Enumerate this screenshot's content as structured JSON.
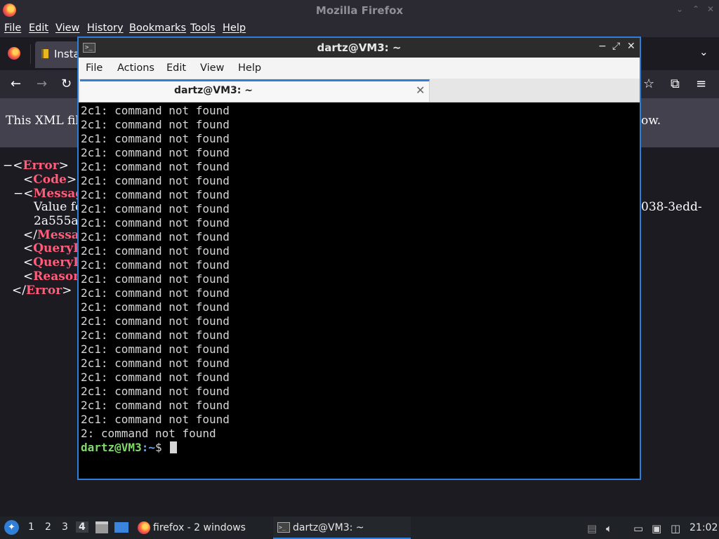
{
  "firefox": {
    "window_title": "Mozilla Firefox",
    "window_controls": [
      "⌄",
      "⌃",
      "✕"
    ],
    "menu": [
      "File",
      "Edit",
      "View",
      "History",
      "Bookmarks",
      "Tools",
      "Help"
    ],
    "tab_label": "Insta",
    "infobar_left": "This XML file",
    "infobar_right": "ow.",
    "xml_lines": {
      "l1_prefix": "−<",
      "l1_tag": "Error",
      "l1_suffix": ">",
      "l2_prefix": "<",
      "l2_tag": "Code",
      "l2_suffix": ">I",
      "l3_prefix": "−<",
      "l3_tag": "Messag",
      "l4_text": "Value fo",
      "l4_right": "038-3edd-",
      "l5_text": "2a555a",
      "l6_prefix": "</",
      "l6_tag": "Messag",
      "l7_prefix": "<",
      "l7_tag": "QueryP",
      "l8_prefix": "<",
      "l8_tag": "QueryP",
      "l9_prefix": "<",
      "l9_tag": "Reason",
      "l10_prefix": "</",
      "l10_tag": "Error",
      "l10_suffix": ">"
    }
  },
  "terminal": {
    "window_title": "dartz@VM3: ~",
    "menu": [
      "File",
      "Actions",
      "Edit",
      "View",
      "Help"
    ],
    "tab_label": "dartz@VM3: ~",
    "output_lines": [
      "2c1: command not found",
      "2c1: command not found",
      "2c1: command not found",
      "2c1: command not found",
      "2c1: command not found",
      "2c1: command not found",
      "2c1: command not found",
      "2c1: command not found",
      "2c1: command not found",
      "2c1: command not found",
      "2c1: command not found",
      "2c1: command not found",
      "2c1: command not found",
      "2c1: command not found",
      "2c1: command not found",
      "2c1: command not found",
      "2c1: command not found",
      "2c1: command not found",
      "2c1: command not found",
      "2c1: command not found",
      "2c1: command not found",
      "2c1: command not found",
      "2c1: command not found",
      "2: command not found"
    ],
    "prompt_user": "dartz@VM3",
    "prompt_sep": ":",
    "prompt_dir": "~",
    "prompt_symbol": "$ "
  },
  "taskbar": {
    "workspaces": [
      "1",
      "2",
      "3",
      "4"
    ],
    "active_workspace": "4",
    "tasks": [
      {
        "label": "firefox - 2 windows",
        "icon": "firefox-icon"
      },
      {
        "label": "dartz@VM3: ~",
        "icon": "terminal-icon"
      }
    ],
    "clock": "21:02"
  },
  "colors": {
    "accent": "#2f7fd9",
    "prompt_user": "#7fda6a",
    "prompt_dir": "#6fa3ef",
    "xml_tag": "#ff5d7a"
  }
}
